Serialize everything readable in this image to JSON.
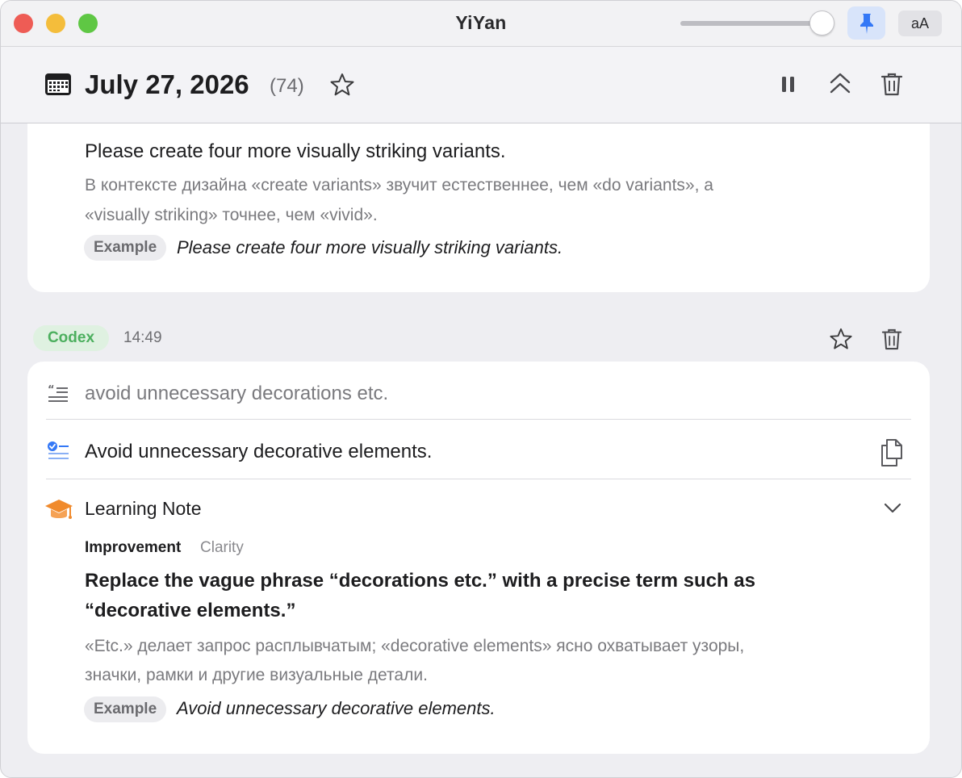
{
  "window": {
    "title": "YiYan",
    "aa_label": "aA"
  },
  "header": {
    "date": "July 27, 2026",
    "count": "(74)"
  },
  "entry1": {
    "translation": "Please create four more visually striking variants.",
    "explanation_line1": "В контексте дизайна «create variants» звучит естественнее, чем «do variants», а",
    "explanation_line2": "«visually striking» точнее, чем «vivid».",
    "example_label": "Example",
    "example_text": "Please create four more visually striking variants."
  },
  "entry2": {
    "source_badge": "Codex",
    "time": "14:49",
    "original": "avoid unnecessary decorations etc.",
    "corrected": "Avoid unnecessary decorative elements.",
    "note_title": "Learning Note",
    "note_category": "Improvement",
    "note_tag": "Clarity",
    "note_heading_line1": "Replace the vague phrase “decorations etc.” with a precise term such as",
    "note_heading_line2": "“decorative elements.”",
    "note_expl_line1": "«Etc.» делает запрос расплывчатым; «decorative elements» ясно охватывает узоры,",
    "note_expl_line2": "значки, рамки и другие визуальные детали.",
    "example_label": "Example",
    "example_text": "Avoid unnecessary decorative elements."
  },
  "colors": {
    "accent_blue": "#3478f6",
    "codex_green": "#4caf5e",
    "learning_orange": "#f08a2c"
  },
  "icons": [
    "calendar-icon",
    "star-icon",
    "pause-icon",
    "collapse-up-icon",
    "trash-icon",
    "pin-icon",
    "quote-icon",
    "checklist-icon",
    "copy-icon",
    "graduation-cap-icon",
    "chevron-down-icon"
  ]
}
